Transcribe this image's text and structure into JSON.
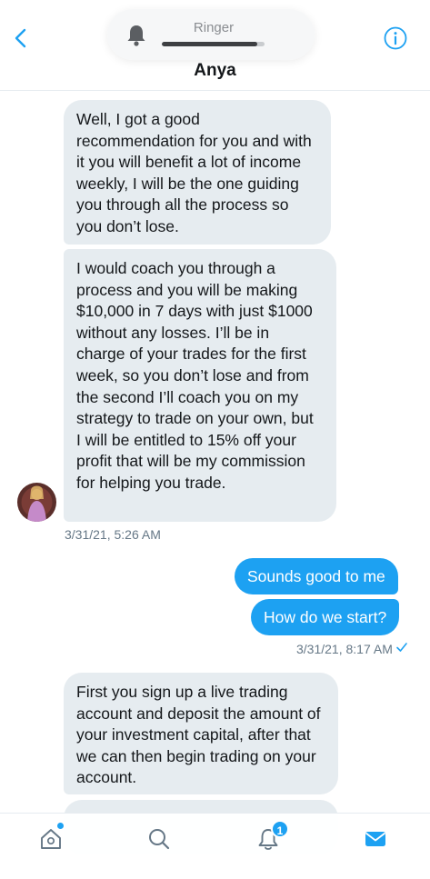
{
  "header": {
    "contact_name": "Anya",
    "back_icon": "chevron-left-icon",
    "info_icon": "info-icon"
  },
  "ringer": {
    "label": "Ringer",
    "icon": "bell-icon",
    "volume_fraction": 0.93
  },
  "messages": [
    {
      "direction": "incoming",
      "text": "Well, I got a good recommendation for you and with it you will benefit a lot of income weekly, I will be the one guiding you through all the process so you don’t lose."
    },
    {
      "direction": "incoming",
      "text": "I would coach you through a process and you will be making $10,000 in 7 days with just $1000 without any losses. I’ll be in charge of your trades for the first week, so you don’t lose and from the second I’ll coach you on my strategy to trade on your own, but I will be entitled to 15% off your profit that will be my commission for helping you trade."
    },
    {
      "direction": "outgoing",
      "text": "Sounds good to me"
    },
    {
      "direction": "outgoing",
      "text": "How do we start?"
    },
    {
      "direction": "incoming",
      "text": "First you sign up a live trading account and deposit the amount of your investment capital, after that we can then begin trading on your account."
    }
  ],
  "timestamps": {
    "incoming_group": "3/31/21, 5:26 AM",
    "outgoing_group": "3/31/21, 8:17 AM"
  },
  "colors": {
    "accent": "#1da1f2",
    "incoming_bubble": "#e6ecf0",
    "timestamp": "#657786"
  },
  "tabbar": {
    "items": [
      "home-icon",
      "search-icon",
      "notifications-icon",
      "messages-icon"
    ],
    "notification_badge": "1"
  }
}
